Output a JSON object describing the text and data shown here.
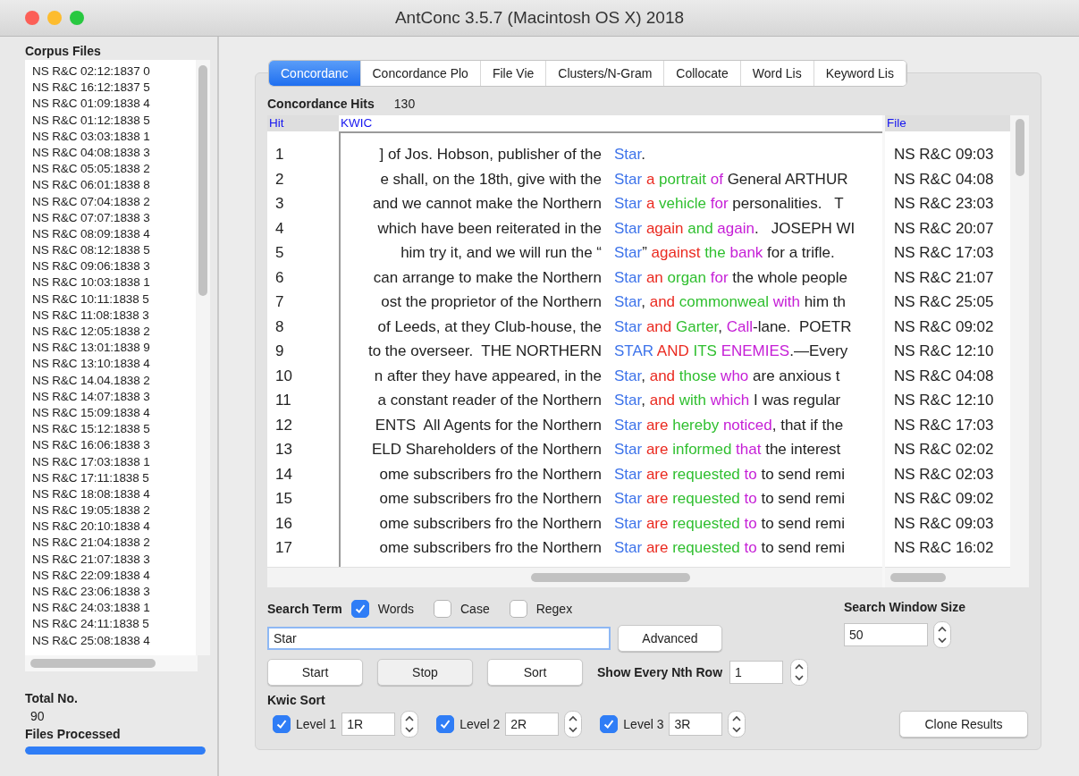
{
  "window": {
    "title": "AntConc 3.5.7 (Macintosh OS X) 2018"
  },
  "corpus_files": {
    "title": "Corpus Files",
    "items": [
      "NS R&C 02:12:1837 0",
      "NS R&C 16:12:1837 5",
      "NS R&C 01:09:1838 4",
      "NS R&C 01:12:1838 5",
      "NS R&C 03:03:1838 1",
      "NS R&C 04:08:1838 3",
      "NS R&C 05:05:1838 2",
      "NS R&C 06:01:1838 8",
      "NS R&C 07:04:1838 2",
      "NS R&C 07:07:1838 3",
      "NS R&C 08:09:1838 4",
      "NS R&C 08:12:1838 5",
      "NS R&C 09:06:1838 3",
      "NS R&C 10:03:1838 1",
      "NS R&C 10:11:1838 5",
      "NS R&C 11:08:1838 3",
      "NS R&C 12:05:1838 2",
      "NS R&C 13:01:1838 9",
      "NS R&C 13:10:1838 4",
      "NS R&C 14.04.1838 2",
      "NS R&C 14:07:1838 3",
      "NS R&C 15:09:1838 4",
      "NS R&C 15:12:1838 5",
      "NS R&C 16:06:1838 3",
      "NS R&C 17:03:1838 1",
      "NS R&C 17:11:1838 5",
      "NS R&C 18:08:1838 4",
      "NS R&C 19:05:1838 2",
      "NS R&C 20:10:1838 4",
      "NS R&C 21:04:1838 2",
      "NS R&C 21:07:1838 3",
      "NS R&C 22:09:1838 4",
      "NS R&C 23:06:1838 3",
      "NS R&C 24:03:1838 1",
      "NS R&C 24:11:1838 5",
      "NS R&C 25:08:1838 4"
    ]
  },
  "total": {
    "label": "Total No.",
    "value": "90"
  },
  "files_processed": {
    "label": "Files Processed",
    "level": 1
  },
  "tabs": [
    {
      "label": "Concordanc",
      "selected": true
    },
    {
      "label": "Concordance Plo",
      "selected": false
    },
    {
      "label": "File Vie",
      "selected": false
    },
    {
      "label": "Clusters/N-Gram",
      "selected": false
    },
    {
      "label": "Collocate",
      "selected": false
    },
    {
      "label": "Word Lis",
      "selected": false
    },
    {
      "label": "Keyword Lis",
      "selected": false
    }
  ],
  "hits_count": {
    "label": "Concordance Hits",
    "value": "130"
  },
  "table": {
    "columns": [
      "Hit",
      "KWIC",
      "File"
    ],
    "rows": [
      {
        "hit": "1",
        "left": "] of Jos. Hobson, publisher of the",
        "right": [
          {
            "text": "Star",
            "color": "#3d73ea"
          },
          {
            "text": "."
          }
        ],
        "file": "NS R&C 09:03"
      },
      {
        "hit": "2",
        "left": "e shall, on the 18th, give with the",
        "right": [
          {
            "text": "Star",
            "color": "#3d73ea"
          },
          {
            "text": " a",
            "color": "#ea2a20"
          },
          {
            "text": " portrait",
            "color": "#2fbf2f"
          },
          {
            "text": " of",
            "color": "#c51ed6"
          },
          {
            "text": " General ARTHUR",
            "color": "#222222"
          }
        ],
        "file": "NS R&C 04:08"
      },
      {
        "hit": "3",
        "left": "and we cannot make the Northern",
        "right": [
          {
            "text": "Star",
            "color": "#3d73ea"
          },
          {
            "text": " a",
            "color": "#ea2a20"
          },
          {
            "text": " vehicle",
            "color": "#2fbf2f"
          },
          {
            "text": " for",
            "color": "#c51ed6"
          },
          {
            "text": " personalities.   T",
            "color": "#222222"
          }
        ],
        "file": "NS R&C 23:03"
      },
      {
        "hit": "4",
        "left": "which have been reiterated in the",
        "right": [
          {
            "text": "Star",
            "color": "#3d73ea"
          },
          {
            "text": " again",
            "color": "#ea2a20"
          },
          {
            "text": " and",
            "color": "#2fbf2f"
          },
          {
            "text": " again",
            "color": "#c51ed6"
          },
          {
            "text": ".   JOSEPH WI",
            "color": "#222222"
          }
        ],
        "file": "NS R&C 20:07"
      },
      {
        "hit": "5",
        "left": "him try it, and we will run the “",
        "right": [
          {
            "text": "Star",
            "color": "#3d73ea"
          },
          {
            "text": "”"
          },
          {
            "text": " against",
            "color": "#ea2a20"
          },
          {
            "text": " the",
            "color": "#2fbf2f"
          },
          {
            "text": " bank",
            "color": "#c51ed6"
          },
          {
            "text": " for a trifle.",
            "color": "#222222"
          }
        ],
        "file": "NS R&C 17:03"
      },
      {
        "hit": "6",
        "left": "can arrange to make the Northern",
        "right": [
          {
            "text": "Star",
            "color": "#3d73ea"
          },
          {
            "text": " an",
            "color": "#ea2a20"
          },
          {
            "text": " organ",
            "color": "#2fbf2f"
          },
          {
            "text": " for",
            "color": "#c51ed6"
          },
          {
            "text": " the whole people",
            "color": "#222222"
          }
        ],
        "file": "NS R&C 21:07"
      },
      {
        "hit": "7",
        "left": "ost the proprietor of the Northern",
        "right": [
          {
            "text": "Star",
            "color": "#3d73ea"
          },
          {
            "text": ","
          },
          {
            "text": " and",
            "color": "#ea2a20"
          },
          {
            "text": " commonweal",
            "color": "#2fbf2f"
          },
          {
            "text": " with",
            "color": "#c51ed6"
          },
          {
            "text": " him th",
            "color": "#222222"
          }
        ],
        "file": "NS R&C 25:05"
      },
      {
        "hit": "8",
        "left": "of Leeds, at they Club-house, the",
        "right": [
          {
            "text": "Star",
            "color": "#3d73ea"
          },
          {
            "text": " and",
            "color": "#ea2a20"
          },
          {
            "text": " Garter",
            "color": "#2fbf2f"
          },
          {
            "text": ","
          },
          {
            "text": " Call",
            "color": "#c51ed6"
          },
          {
            "text": "-lane.  POETR",
            "color": "#222222"
          }
        ],
        "file": "NS R&C 09:02"
      },
      {
        "hit": "9",
        "left": "to the overseer.  THE NORTHERN",
        "right": [
          {
            "text": "STAR",
            "color": "#3d73ea"
          },
          {
            "text": " AND",
            "color": "#ea2a20"
          },
          {
            "text": " ITS",
            "color": "#2fbf2f"
          },
          {
            "text": " ENEMIES",
            "color": "#c51ed6"
          },
          {
            "text": ".—Every",
            "color": "#222222"
          }
        ],
        "file": "NS R&C 12:10"
      },
      {
        "hit": "10",
        "left": "n after they have appeared, in the",
        "right": [
          {
            "text": "Star",
            "color": "#3d73ea"
          },
          {
            "text": ","
          },
          {
            "text": " and",
            "color": "#ea2a20"
          },
          {
            "text": " those",
            "color": "#2fbf2f"
          },
          {
            "text": " who",
            "color": "#c51ed6"
          },
          {
            "text": " are anxious t",
            "color": "#222222"
          }
        ],
        "file": "NS R&C 04:08"
      },
      {
        "hit": "11",
        "left": "a constant reader of the Northern",
        "right": [
          {
            "text": "Star",
            "color": "#3d73ea"
          },
          {
            "text": ","
          },
          {
            "text": " and",
            "color": "#ea2a20"
          },
          {
            "text": " with",
            "color": "#2fbf2f"
          },
          {
            "text": " which",
            "color": "#c51ed6"
          },
          {
            "text": " I was regular",
            "color": "#222222"
          }
        ],
        "file": "NS R&C 12:10"
      },
      {
        "hit": "12",
        "left": "ENTS  All Agents for the Northern",
        "right": [
          {
            "text": "Star",
            "color": "#3d73ea"
          },
          {
            "text": " are",
            "color": "#ea2a20"
          },
          {
            "text": " hereby",
            "color": "#2fbf2f"
          },
          {
            "text": " noticed",
            "color": "#c51ed6"
          },
          {
            "text": ", that if the",
            "color": "#222222"
          }
        ],
        "file": "NS R&C 17:03"
      },
      {
        "hit": "13",
        "left": "ELD Shareholders of the Northern",
        "right": [
          {
            "text": "Star",
            "color": "#3d73ea"
          },
          {
            "text": " are",
            "color": "#ea2a20"
          },
          {
            "text": " informed",
            "color": "#2fbf2f"
          },
          {
            "text": " that",
            "color": "#c51ed6"
          },
          {
            "text": " the interest",
            "color": "#222222"
          }
        ],
        "file": "NS R&C 02:02"
      },
      {
        "hit": "14",
        "left": "ome subscribers fro the Northern",
        "right": [
          {
            "text": "Star",
            "color": "#3d73ea"
          },
          {
            "text": " are",
            "color": "#ea2a20"
          },
          {
            "text": " requested",
            "color": "#2fbf2f"
          },
          {
            "text": " to",
            "color": "#c51ed6"
          },
          {
            "text": " to send remi",
            "color": "#222222"
          }
        ],
        "file": "NS R&C 02:03"
      },
      {
        "hit": "15",
        "left": "ome subscribers fro the Northern",
        "right": [
          {
            "text": "Star",
            "color": "#3d73ea"
          },
          {
            "text": " are",
            "color": "#ea2a20"
          },
          {
            "text": " requested",
            "color": "#2fbf2f"
          },
          {
            "text": " to",
            "color": "#c51ed6"
          },
          {
            "text": " to send remi",
            "color": "#222222"
          }
        ],
        "file": "NS R&C 09:02"
      },
      {
        "hit": "16",
        "left": "ome subscribers fro the Northern",
        "right": [
          {
            "text": "Star",
            "color": "#3d73ea"
          },
          {
            "text": " are",
            "color": "#ea2a20"
          },
          {
            "text": " requested",
            "color": "#2fbf2f"
          },
          {
            "text": " to",
            "color": "#c51ed6"
          },
          {
            "text": " to send remi",
            "color": "#222222"
          }
        ],
        "file": "NS R&C 09:03"
      },
      {
        "hit": "17",
        "left": "ome subscribers fro the Northern",
        "right": [
          {
            "text": "Star",
            "color": "#3d73ea"
          },
          {
            "text": " are",
            "color": "#ea2a20"
          },
          {
            "text": " requested",
            "color": "#2fbf2f"
          },
          {
            "text": " to",
            "color": "#c51ed6"
          },
          {
            "text": " to send remi",
            "color": "#222222"
          }
        ],
        "file": "NS R&C 16:02"
      }
    ]
  },
  "search": {
    "label": "Search Term",
    "options": [
      {
        "label": "Words",
        "checked": true
      },
      {
        "label": "Case",
        "checked": false
      },
      {
        "label": "Regex",
        "checked": false
      }
    ],
    "value": "Star",
    "advanced": "Advanced"
  },
  "window_size": {
    "label": "Search Window Size",
    "value": "50"
  },
  "actions": [
    {
      "label": "Start",
      "disabled": false
    },
    {
      "label": "Stop",
      "disabled": true
    },
    {
      "label": "Sort",
      "disabled": false
    }
  ],
  "nth_row": {
    "label": "Show Every Nth Row",
    "value": "1"
  },
  "kwic_sort": {
    "label": "Kwic Sort",
    "levels": [
      {
        "label": "Level 1",
        "checked": true,
        "value": "1R"
      },
      {
        "label": "Level 2",
        "checked": true,
        "value": "2R"
      },
      {
        "label": "Level 3",
        "checked": true,
        "value": "3R"
      }
    ]
  },
  "clone": "Clone Results"
}
